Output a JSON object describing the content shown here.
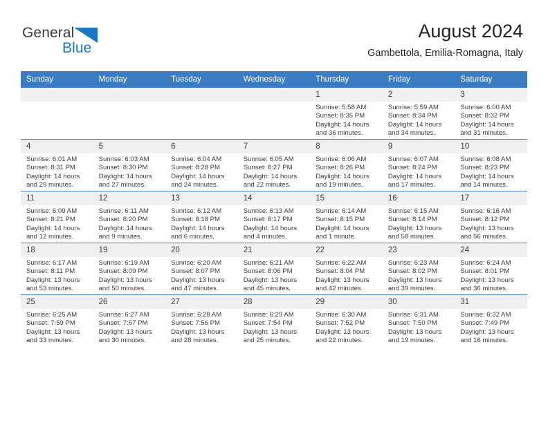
{
  "logo": {
    "word_one": "General",
    "word_two": "Blue",
    "triangle_icon": "blue-triangle-icon",
    "brand_color": "#1878c4"
  },
  "header": {
    "title": "August 2024",
    "subtitle": "Gambettola, Emilia-Romagna, Italy"
  },
  "colors": {
    "header_band": "#3b7dc0",
    "daynum_band": "#f0f0f0",
    "text": "#3b3b3b"
  },
  "weekdays": [
    "Sunday",
    "Monday",
    "Tuesday",
    "Wednesday",
    "Thursday",
    "Friday",
    "Saturday"
  ],
  "labels": {
    "sunrise": "Sunrise:",
    "sunset": "Sunset:",
    "daylight": "Daylight:"
  },
  "weeks": [
    [
      {
        "day": "",
        "sunrise": "",
        "sunset": "",
        "daylight_a": "",
        "daylight_b": ""
      },
      {
        "day": "",
        "sunrise": "",
        "sunset": "",
        "daylight_a": "",
        "daylight_b": ""
      },
      {
        "day": "",
        "sunrise": "",
        "sunset": "",
        "daylight_a": "",
        "daylight_b": ""
      },
      {
        "day": "",
        "sunrise": "",
        "sunset": "",
        "daylight_a": "",
        "daylight_b": ""
      },
      {
        "day": "1",
        "sunrise": "Sunrise: 5:58 AM",
        "sunset": "Sunset: 8:35 PM",
        "daylight_a": "Daylight: 14 hours",
        "daylight_b": "and 36 minutes."
      },
      {
        "day": "2",
        "sunrise": "Sunrise: 5:59 AM",
        "sunset": "Sunset: 8:34 PM",
        "daylight_a": "Daylight: 14 hours",
        "daylight_b": "and 34 minutes."
      },
      {
        "day": "3",
        "sunrise": "Sunrise: 6:00 AM",
        "sunset": "Sunset: 8:32 PM",
        "daylight_a": "Daylight: 14 hours",
        "daylight_b": "and 31 minutes."
      }
    ],
    [
      {
        "day": "4",
        "sunrise": "Sunrise: 6:01 AM",
        "sunset": "Sunset: 8:31 PM",
        "daylight_a": "Daylight: 14 hours",
        "daylight_b": "and 29 minutes."
      },
      {
        "day": "5",
        "sunrise": "Sunrise: 6:03 AM",
        "sunset": "Sunset: 8:30 PM",
        "daylight_a": "Daylight: 14 hours",
        "daylight_b": "and 27 minutes."
      },
      {
        "day": "6",
        "sunrise": "Sunrise: 6:04 AM",
        "sunset": "Sunset: 8:28 PM",
        "daylight_a": "Daylight: 14 hours",
        "daylight_b": "and 24 minutes."
      },
      {
        "day": "7",
        "sunrise": "Sunrise: 6:05 AM",
        "sunset": "Sunset: 8:27 PM",
        "daylight_a": "Daylight: 14 hours",
        "daylight_b": "and 22 minutes."
      },
      {
        "day": "8",
        "sunrise": "Sunrise: 6:06 AM",
        "sunset": "Sunset: 8:26 PM",
        "daylight_a": "Daylight: 14 hours",
        "daylight_b": "and 19 minutes."
      },
      {
        "day": "9",
        "sunrise": "Sunrise: 6:07 AM",
        "sunset": "Sunset: 8:24 PM",
        "daylight_a": "Daylight: 14 hours",
        "daylight_b": "and 17 minutes."
      },
      {
        "day": "10",
        "sunrise": "Sunrise: 6:08 AM",
        "sunset": "Sunset: 8:23 PM",
        "daylight_a": "Daylight: 14 hours",
        "daylight_b": "and 14 minutes."
      }
    ],
    [
      {
        "day": "11",
        "sunrise": "Sunrise: 6:09 AM",
        "sunset": "Sunset: 8:21 PM",
        "daylight_a": "Daylight: 14 hours",
        "daylight_b": "and 12 minutes."
      },
      {
        "day": "12",
        "sunrise": "Sunrise: 6:11 AM",
        "sunset": "Sunset: 8:20 PM",
        "daylight_a": "Daylight: 14 hours",
        "daylight_b": "and 9 minutes."
      },
      {
        "day": "13",
        "sunrise": "Sunrise: 6:12 AM",
        "sunset": "Sunset: 8:18 PM",
        "daylight_a": "Daylight: 14 hours",
        "daylight_b": "and 6 minutes."
      },
      {
        "day": "14",
        "sunrise": "Sunrise: 6:13 AM",
        "sunset": "Sunset: 8:17 PM",
        "daylight_a": "Daylight: 14 hours",
        "daylight_b": "and 4 minutes."
      },
      {
        "day": "15",
        "sunrise": "Sunrise: 6:14 AM",
        "sunset": "Sunset: 8:15 PM",
        "daylight_a": "Daylight: 14 hours",
        "daylight_b": "and 1 minute."
      },
      {
        "day": "16",
        "sunrise": "Sunrise: 6:15 AM",
        "sunset": "Sunset: 8:14 PM",
        "daylight_a": "Daylight: 13 hours",
        "daylight_b": "and 58 minutes."
      },
      {
        "day": "17",
        "sunrise": "Sunrise: 6:16 AM",
        "sunset": "Sunset: 8:12 PM",
        "daylight_a": "Daylight: 13 hours",
        "daylight_b": "and 56 minutes."
      }
    ],
    [
      {
        "day": "18",
        "sunrise": "Sunrise: 6:17 AM",
        "sunset": "Sunset: 8:11 PM",
        "daylight_a": "Daylight: 13 hours",
        "daylight_b": "and 53 minutes."
      },
      {
        "day": "19",
        "sunrise": "Sunrise: 6:19 AM",
        "sunset": "Sunset: 8:09 PM",
        "daylight_a": "Daylight: 13 hours",
        "daylight_b": "and 50 minutes."
      },
      {
        "day": "20",
        "sunrise": "Sunrise: 6:20 AM",
        "sunset": "Sunset: 8:07 PM",
        "daylight_a": "Daylight: 13 hours",
        "daylight_b": "and 47 minutes."
      },
      {
        "day": "21",
        "sunrise": "Sunrise: 6:21 AM",
        "sunset": "Sunset: 8:06 PM",
        "daylight_a": "Daylight: 13 hours",
        "daylight_b": "and 45 minutes."
      },
      {
        "day": "22",
        "sunrise": "Sunrise: 6:22 AM",
        "sunset": "Sunset: 8:04 PM",
        "daylight_a": "Daylight: 13 hours",
        "daylight_b": "and 42 minutes."
      },
      {
        "day": "23",
        "sunrise": "Sunrise: 6:23 AM",
        "sunset": "Sunset: 8:02 PM",
        "daylight_a": "Daylight: 13 hours",
        "daylight_b": "and 39 minutes."
      },
      {
        "day": "24",
        "sunrise": "Sunrise: 6:24 AM",
        "sunset": "Sunset: 8:01 PM",
        "daylight_a": "Daylight: 13 hours",
        "daylight_b": "and 36 minutes."
      }
    ],
    [
      {
        "day": "25",
        "sunrise": "Sunrise: 6:25 AM",
        "sunset": "Sunset: 7:59 PM",
        "daylight_a": "Daylight: 13 hours",
        "daylight_b": "and 33 minutes."
      },
      {
        "day": "26",
        "sunrise": "Sunrise: 6:27 AM",
        "sunset": "Sunset: 7:57 PM",
        "daylight_a": "Daylight: 13 hours",
        "daylight_b": "and 30 minutes."
      },
      {
        "day": "27",
        "sunrise": "Sunrise: 6:28 AM",
        "sunset": "Sunset: 7:56 PM",
        "daylight_a": "Daylight: 13 hours",
        "daylight_b": "and 28 minutes."
      },
      {
        "day": "28",
        "sunrise": "Sunrise: 6:29 AM",
        "sunset": "Sunset: 7:54 PM",
        "daylight_a": "Daylight: 13 hours",
        "daylight_b": "and 25 minutes."
      },
      {
        "day": "29",
        "sunrise": "Sunrise: 6:30 AM",
        "sunset": "Sunset: 7:52 PM",
        "daylight_a": "Daylight: 13 hours",
        "daylight_b": "and 22 minutes."
      },
      {
        "day": "30",
        "sunrise": "Sunrise: 6:31 AM",
        "sunset": "Sunset: 7:50 PM",
        "daylight_a": "Daylight: 13 hours",
        "daylight_b": "and 19 minutes."
      },
      {
        "day": "31",
        "sunrise": "Sunrise: 6:32 AM",
        "sunset": "Sunset: 7:49 PM",
        "daylight_a": "Daylight: 13 hours",
        "daylight_b": "and 16 minutes."
      }
    ]
  ]
}
